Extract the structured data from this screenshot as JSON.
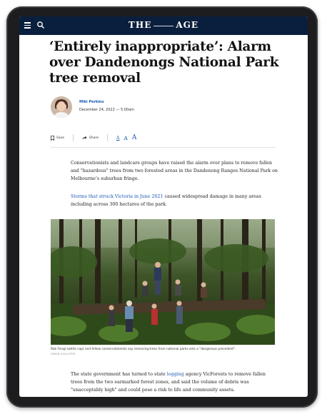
{
  "header": {
    "masthead_left": "THE",
    "masthead_right": "AGE"
  },
  "article": {
    "headline": "‘Entirely inappropriate’: Alarm over Dandenongs National Park tree removal",
    "author": "Miki Perkins",
    "date": "December 24, 2022 — 5.00am",
    "paragraph1": "Conservationists and landcare groups have raised the alarm over plans to remove fallen and \"hazardous\" trees from two forested areas in the Dandenong Ranges National Park on Melbourne’s suburban fringe.",
    "paragraph2_link": "Storms that struck Victoria in June 2021",
    "paragraph2_rest": " caused widespread damage in many areas including across 300 hectares of the park.",
    "caption": "Rob Fengl (white cap) and fellow conservationists say removing trees from national parks sets a \"dangerous precedent\".",
    "photo_credit": "SIMON SCHLUTER",
    "paragraph3_pre": "The state government has turned to state ",
    "paragraph3_link": "logging",
    "paragraph3_rest": " agency VicForests to remove fallen trees from the two earmarked forest zones, and said the volume of debris was \"unacceptably high\" and could pose a risk to life and community assets."
  },
  "toolbar": {
    "save_label": "Save",
    "share_label": "Share",
    "text_size_small": "A",
    "text_size_medium": "A",
    "text_size_large": "A"
  },
  "colors": {
    "nav_bg": "#0a1f3d",
    "link": "#1a57b5",
    "bezel": "#1d1d1f"
  },
  "icons": [
    "menu-icon",
    "search-icon",
    "bookmark-icon",
    "share-icon"
  ]
}
